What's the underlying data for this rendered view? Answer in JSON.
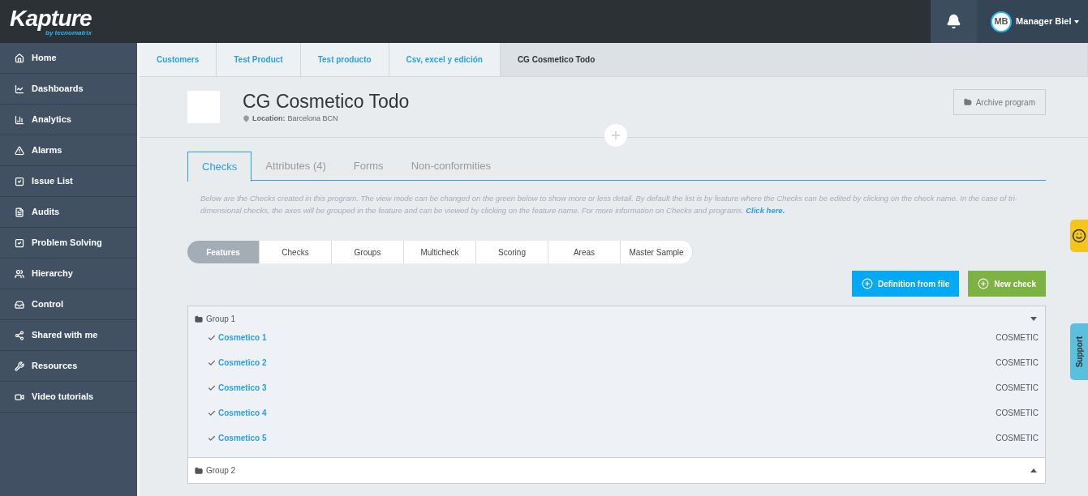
{
  "logo": {
    "name": "Kapture",
    "byline": "by tecnomatrix"
  },
  "topbar": {
    "avatar_initials": "MB",
    "user": "Manager Biel"
  },
  "sidebar": {
    "items": [
      {
        "label": "Home",
        "selected": false
      },
      {
        "label": "Dashboards",
        "selected": false
      },
      {
        "label": "Analytics",
        "selected": false
      },
      {
        "label": "Alarms",
        "selected": false
      },
      {
        "label": "Issue List",
        "selected": false
      },
      {
        "label": "Audits",
        "selected": false
      },
      {
        "label": "Problem Solving",
        "selected": false
      },
      {
        "label": "Hierarchy",
        "selected": false
      },
      {
        "label": "Control",
        "selected": false
      },
      {
        "label": "Shared with me",
        "selected": false
      },
      {
        "label": "Resources",
        "selected": false
      },
      {
        "label": "Video tutorials",
        "selected": false
      }
    ]
  },
  "breadcrumbs": [
    {
      "label": "Customers",
      "current": false
    },
    {
      "label": "Test Product",
      "current": false
    },
    {
      "label": "Test producto",
      "current": false
    },
    {
      "label": "Csv, excel y edición",
      "current": false
    },
    {
      "label": "CG Cosmetico Todo",
      "current": true
    }
  ],
  "program": {
    "title": "CG Cosmetico Todo",
    "location_label": "Location:",
    "location": "Barcelona BCN",
    "archive_button": "Archive program"
  },
  "tabs": [
    {
      "label": "Checks",
      "selected": true
    },
    {
      "label": "Attributes (4)",
      "selected": false
    },
    {
      "label": "Forms",
      "selected": false
    },
    {
      "label": "Non-conformities",
      "selected": false
    }
  ],
  "description": "Below are the Checks created in this program. The view mode can be changed on the green below to show more or less detail. By default the list is by feature where the Checks can be edited by clicking on the check name. In the case of tri-dimensional checks, the axes will be grouped in the feature and can be viewed by clicking on the feature name. For more information on Checks and programs.",
  "description_link": "Click here.",
  "view_modes": [
    {
      "label": "Features",
      "selected": true
    },
    {
      "label": "Checks",
      "selected": false
    },
    {
      "label": "Groups",
      "selected": false
    },
    {
      "label": "Multicheck",
      "selected": false
    },
    {
      "label": "Scoring",
      "selected": false
    },
    {
      "label": "Areas",
      "selected": false
    },
    {
      "label": "Master Sample",
      "selected": false
    }
  ],
  "actions": [
    {
      "label": "Definition from file",
      "kind": "blue"
    },
    {
      "label": "New check",
      "kind": "green"
    }
  ],
  "groups": [
    {
      "name": "Group 1",
      "expanded": true,
      "checks": [
        {
          "name": "Cosmetico 1",
          "type": "COSMETIC"
        },
        {
          "name": "Cosmetico 2",
          "type": "COSMETIC"
        },
        {
          "name": "Cosmetico 3",
          "type": "COSMETIC"
        },
        {
          "name": "Cosmetico 4",
          "type": "COSMETIC"
        },
        {
          "name": "Cosmetico 5",
          "type": "COSMETIC"
        }
      ]
    },
    {
      "name": "Group 2",
      "expanded": false
    }
  ],
  "side_tabs": {
    "support": "Support"
  }
}
